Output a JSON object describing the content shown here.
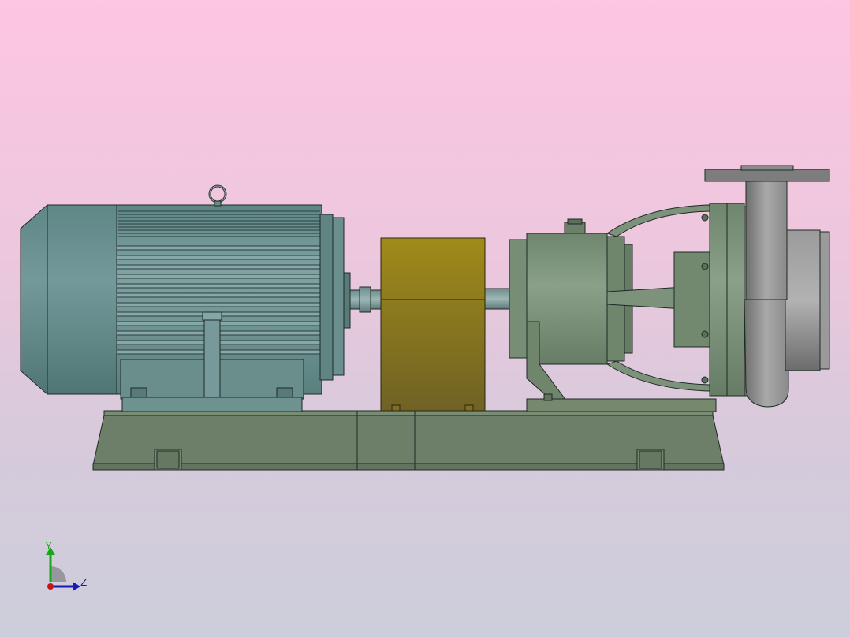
{
  "viewport": {
    "background_top": "#fdc6e2",
    "background_bottom": "#cdcedb"
  },
  "model": {
    "motor_color": "#6f9493",
    "coupling_guard_color": "#8c7a1e",
    "pump_color": "#7d927b",
    "base_color": "#6d7f68",
    "volute_color": "#8f8f8f",
    "outline_color": "#1e2a26"
  },
  "triad": {
    "y_label": "Y",
    "z_label": "Z",
    "y_color": "#1aa51a",
    "z_color": "#1a1ab4",
    "x_color": "#c01818"
  }
}
